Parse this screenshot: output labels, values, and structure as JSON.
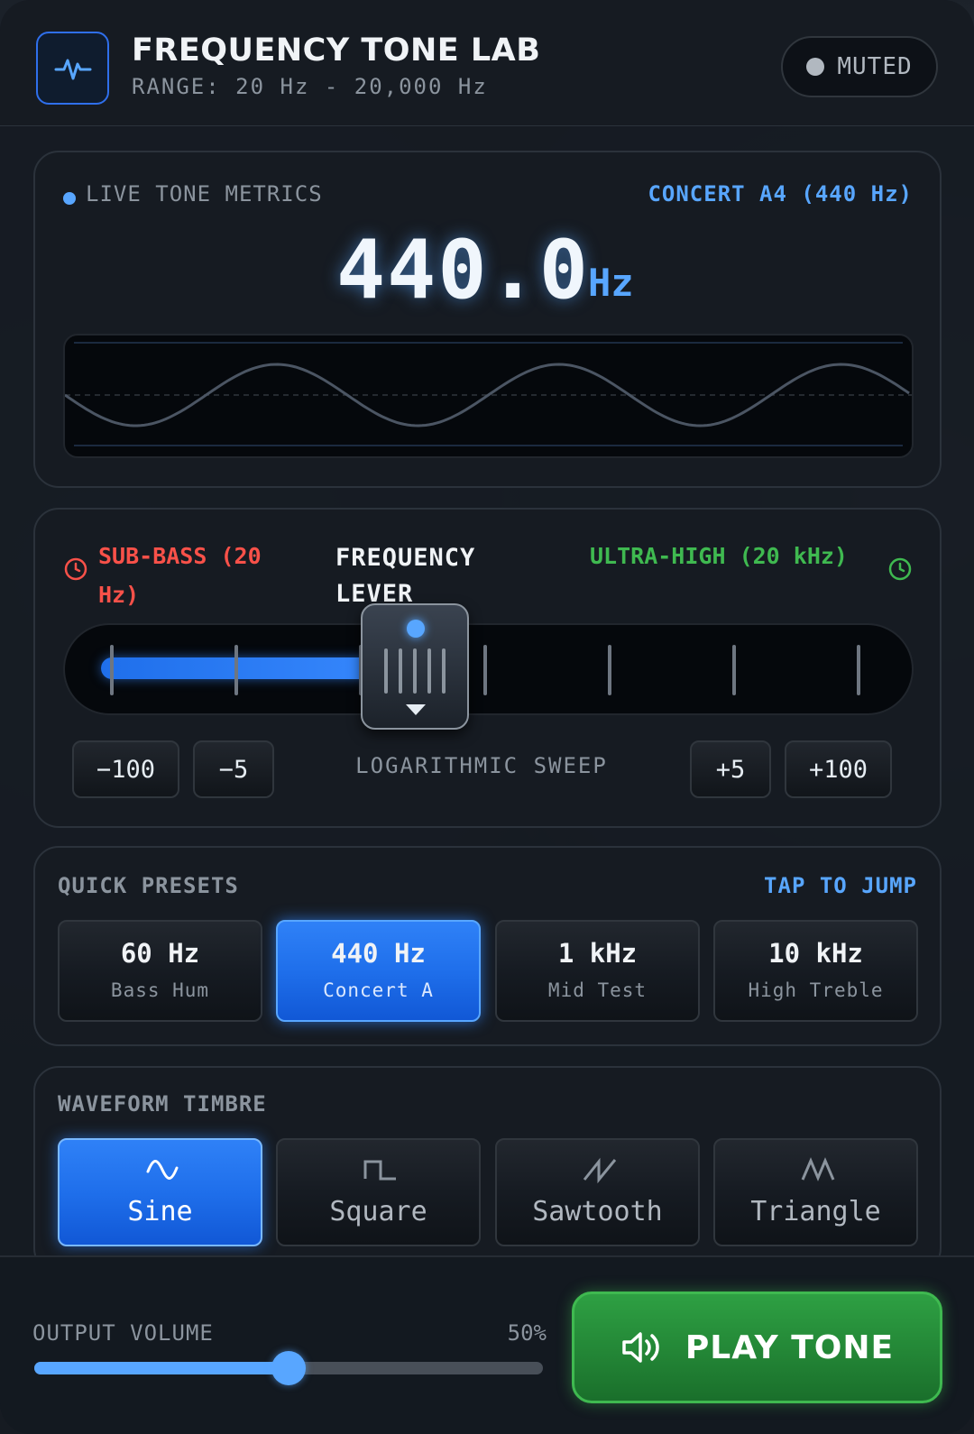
{
  "header": {
    "title": "FREQUENCY TONE LAB",
    "subtitle": "RANGE: 20 Hz - 20,000 Hz",
    "status_label": "MUTED",
    "logo_icon": "waveform-pulse-icon"
  },
  "metrics": {
    "label": "LIVE TONE METRICS",
    "note_label": "CONCERT A4 (440 Hz)",
    "frequency_value": "440.0",
    "frequency_unit": "Hz"
  },
  "lever": {
    "low_label": "SUB-BASS (20 Hz)",
    "title": "FREQUENCY LEVER",
    "high_label": "ULTRA-HIGH (20 kHz)",
    "position_fraction": 0.4,
    "sweep_label": "LOGARITHMIC SWEEP",
    "steps": [
      "−100",
      "−5",
      "+5",
      "+100"
    ]
  },
  "presets": {
    "title": "QUICK PRESETS",
    "hint": "TAP TO JUMP",
    "items": [
      {
        "value": "60 Hz",
        "name": "Bass Hum",
        "active": false
      },
      {
        "value": "440 Hz",
        "name": "Concert A",
        "active": true
      },
      {
        "value": "1 kHz",
        "name": "Mid Test",
        "active": false
      },
      {
        "value": "10 kHz",
        "name": "High Treble",
        "active": false
      }
    ]
  },
  "waveform": {
    "title": "WAVEFORM TIMBRE",
    "items": [
      {
        "label": "Sine",
        "icon": "sine-wave-icon",
        "active": true
      },
      {
        "label": "Square",
        "icon": "square-wave-icon",
        "active": false
      },
      {
        "label": "Sawtooth",
        "icon": "sawtooth-wave-icon",
        "active": false
      },
      {
        "label": "Triangle",
        "icon": "triangle-wave-icon",
        "active": false
      }
    ]
  },
  "footer": {
    "volume_label": "OUTPUT VOLUME",
    "volume_value": "50%",
    "volume_fraction": 0.5,
    "play_label": "PLAY TONE",
    "play_icon": "speaker-icon"
  },
  "colors": {
    "accent": "#58a6ff",
    "low": "#f85149",
    "high": "#3fb950",
    "play": "#238636"
  }
}
